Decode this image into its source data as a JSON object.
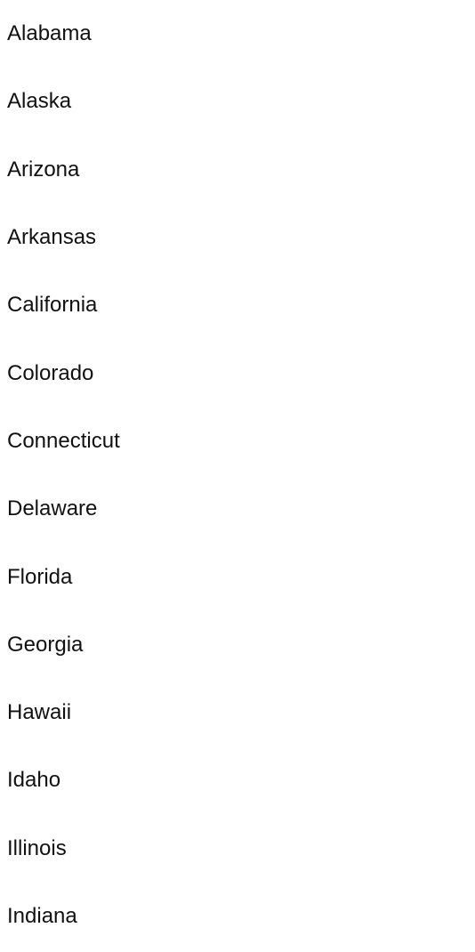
{
  "states": [
    "Alabama",
    "Alaska",
    "Arizona",
    "Arkansas",
    "California",
    "Colorado",
    "Connecticut",
    "Delaware",
    "Florida",
    "Georgia",
    "Hawaii",
    "Idaho",
    "Illinois",
    "Indiana"
  ]
}
